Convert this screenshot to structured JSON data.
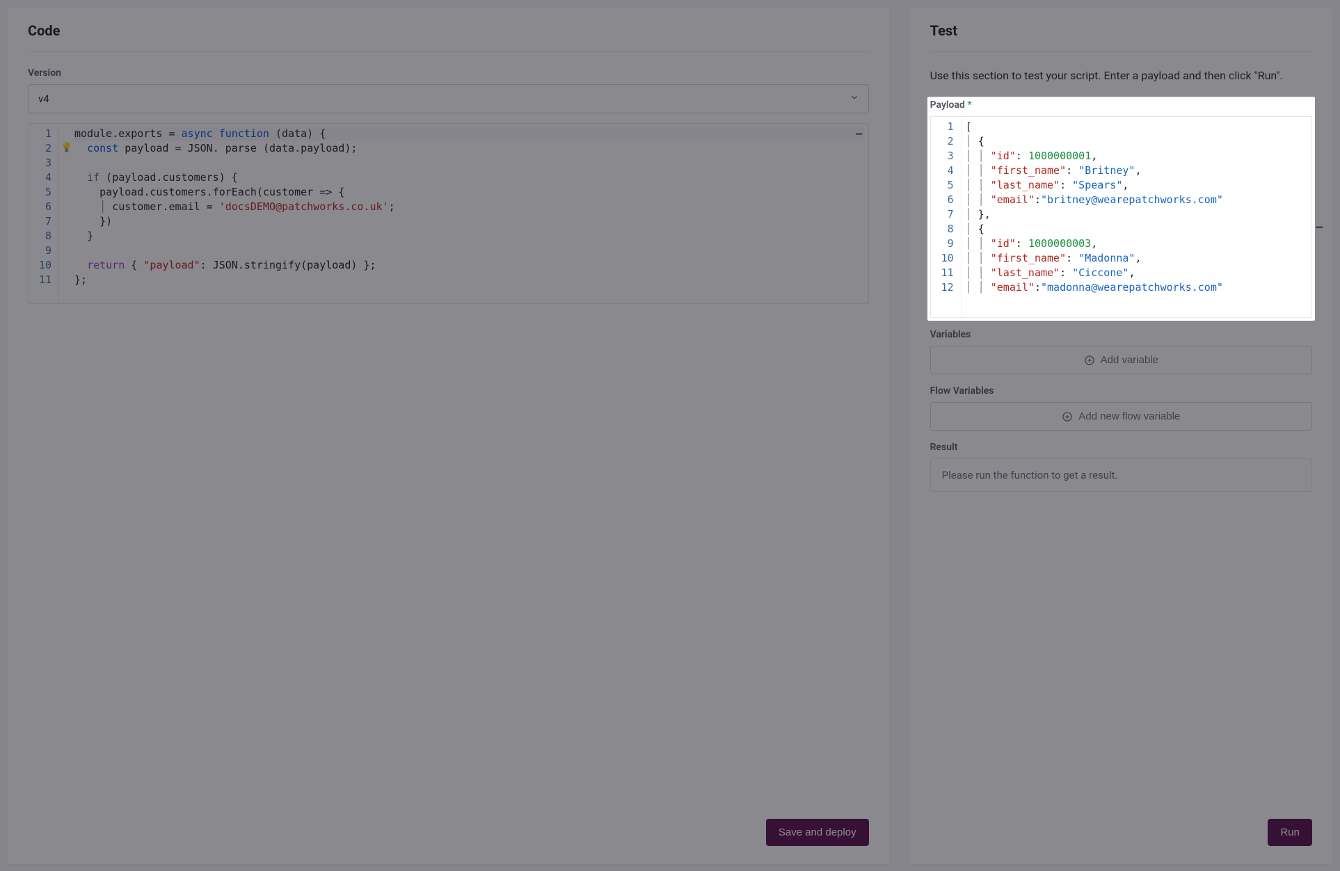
{
  "code_panel": {
    "title": "Code",
    "version_label": "Version",
    "version_value": "v4",
    "save_button": "Save and deploy",
    "code_lines": [
      {
        "n": 1,
        "hint": "",
        "html": "<span class='obj'>module</span><span class='punc'>.</span><span class='prop'>exports</span> <span class='punc'>=</span> <span class='kw'>async function</span> <span class='punc'>(</span><span class='obj'>data</span><span class='punc'>) {</span>"
      },
      {
        "n": 2,
        "hint": "bulb",
        "html": "  <span class='kw'>const</span> <span class='obj'>payload</span> <span class='punc'>=</span> <span class='obj'>JSON</span><span class='punc'>.</span> <span class='fn'>parse</span> <span class='punc'>(</span><span class='obj'>data</span><span class='punc'>.</span><span class='prop'>payload</span><span class='punc'>);</span>"
      },
      {
        "n": 3,
        "hint": "",
        "html": ""
      },
      {
        "n": 4,
        "hint": "",
        "html": "  <span class='kw2'>if</span> <span class='punc'>(</span><span class='obj'>payload</span><span class='punc'>.</span><span class='prop'>customers</span><span class='punc'>) {</span>"
      },
      {
        "n": 5,
        "hint": "",
        "html": "    <span class='obj'>payload</span><span class='punc'>.</span><span class='prop'>customers</span><span class='punc'>.</span><span class='fn'>forEach</span><span class='punc'>(</span><span class='obj'>customer</span> <span class='punc'>=&gt; {</span>"
      },
      {
        "n": 6,
        "hint": "",
        "html": "    <span class='guide'>│ </span><span class='obj'>customer</span><span class='punc'>.</span><span class='prop'>email</span> <span class='punc'>=</span> <span class='strd'>'docsDEMO@patchworks.co.uk'</span><span class='punc'>;</span>"
      },
      {
        "n": 7,
        "hint": "",
        "html": "    <span class='punc'>})</span>"
      },
      {
        "n": 8,
        "hint": "",
        "html": "  <span class='punc'>}</span>"
      },
      {
        "n": 9,
        "hint": "",
        "html": ""
      },
      {
        "n": 10,
        "hint": "",
        "html": "  <span class='kw2'>return</span> <span class='punc'>{</span> <span class='str'>\"payload\"</span><span class='punc'>:</span> <span class='obj'>JSON</span><span class='punc'>.</span><span class='fn'>stringify</span><span class='punc'>(</span><span class='obj'>payload</span><span class='punc'>) };</span>"
      },
      {
        "n": 11,
        "hint": "",
        "html": "<span class='punc'>};</span>"
      }
    ]
  },
  "test_panel": {
    "title": "Test",
    "help": "Use this section to test your script. Enter a payload and then click \"Run\".",
    "payload_label": "Payload",
    "payload_required": "*",
    "variables_label": "Variables",
    "add_variable": "Add variable",
    "flow_variables_label": "Flow Variables",
    "add_flow_variable": "Add new flow variable",
    "result_label": "Result",
    "result_placeholder": "Please run the function to get a result.",
    "run_button": "Run",
    "payload_lines": [
      {
        "n": 1,
        "html": "<span class='punc'>[</span>"
      },
      {
        "n": 2,
        "html": "<span class='guide'>│ </span><span class='punc'>{</span>"
      },
      {
        "n": 3,
        "html": "<span class='guide'>│ │ </span><span class='key'>\"id\"</span><span class='punc'>: </span><span class='num'>1000000001</span><span class='punc'>,</span>"
      },
      {
        "n": 4,
        "html": "<span class='guide'>│ │ </span><span class='key'>\"first_name\"</span><span class='punc'>: </span><span class='valb'>\"Britney\"</span><span class='punc'>,</span>"
      },
      {
        "n": 5,
        "html": "<span class='guide'>│ │ </span><span class='key'>\"last_name\"</span><span class='punc'>: </span><span class='valb'>\"Spears\"</span><span class='punc'>,</span>"
      },
      {
        "n": 6,
        "html": "<span class='guide'>│ │ </span><span class='key'>\"email\"</span><span class='punc'>:</span><span class='valb'>\"britney@wearepatchworks.com\"</span>"
      },
      {
        "n": 7,
        "html": "<span class='guide'>│ </span><span class='punc'>},</span>"
      },
      {
        "n": 8,
        "html": "<span class='guide'>│ </span><span class='punc'>{</span>"
      },
      {
        "n": 9,
        "html": "<span class='guide'>│ │ </span><span class='key'>\"id\"</span><span class='punc'>: </span><span class='num'>1000000003</span><span class='punc'>,</span>"
      },
      {
        "n": 10,
        "html": "<span class='guide'>│ │ </span><span class='key'>\"first_name\"</span><span class='punc'>: </span><span class='valb'>\"Madonna\"</span><span class='punc'>,</span>"
      },
      {
        "n": 11,
        "html": "<span class='guide'>│ │ </span><span class='key'>\"last_name\"</span><span class='punc'>: </span><span class='valb'>\"Ciccone\"</span><span class='punc'>,</span>"
      },
      {
        "n": 12,
        "html": "<span class='guide'>│ │ </span><span class='key'>\"email\"</span><span class='punc'>:</span><span class='valb'>\"madonna@wearepatchworks.com\"</span>"
      }
    ]
  }
}
